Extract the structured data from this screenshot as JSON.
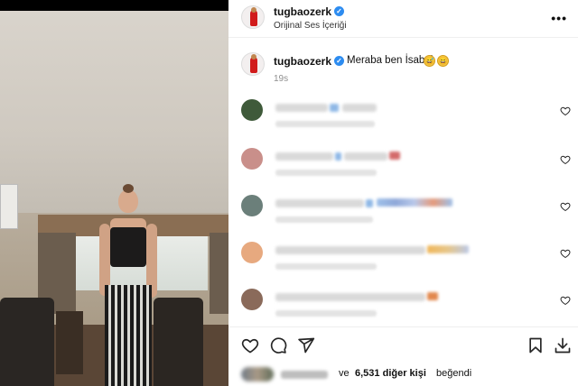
{
  "post": {
    "username": "tugbaozerk",
    "audio_label": "Orijinal Ses İçeriği",
    "more_icon": "more-dots-icon",
    "verified_icon": "verified-badge-icon"
  },
  "caption": {
    "username": "tugbaozerk",
    "text": "Meraba ben İsabel",
    "emojis": [
      "😅",
      "😄"
    ],
    "time": "19s"
  },
  "comments": [
    {
      "avatar_color": "#3f5a3a"
    },
    {
      "avatar_color": "#c98f8a"
    },
    {
      "avatar_color": "#6b7f7a"
    },
    {
      "avatar_color": "#e7a97f"
    },
    {
      "avatar_color": "#8a6a5a"
    }
  ],
  "actions": {
    "like_icon": "heart-icon",
    "comment_icon": "comment-bubble-icon",
    "share_icon": "share-paper-plane-icon",
    "save_icon": "bookmark-icon",
    "download_icon": "download-icon"
  },
  "likes": {
    "connector": "ve",
    "count": "6,531",
    "others_label": "diğer kişi",
    "suffix": "beğendi"
  },
  "colors": {
    "verified": "#2d8cf0",
    "muted": "#8e8e8e"
  }
}
